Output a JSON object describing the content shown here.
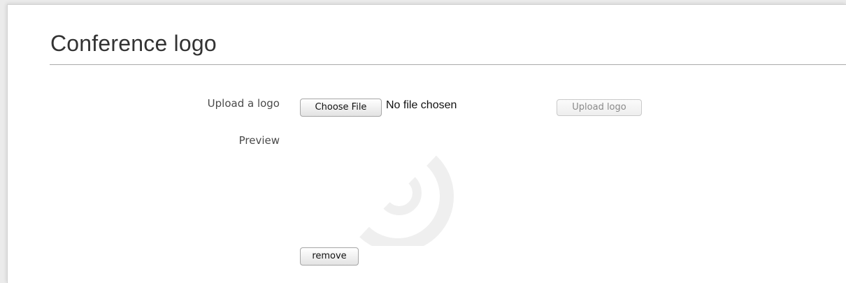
{
  "section": {
    "title": "Conference logo"
  },
  "upload": {
    "label": "Upload a logo",
    "choose_button": "Choose File",
    "file_status": "No file chosen",
    "upload_button": "Upload logo"
  },
  "preview": {
    "label": "Preview",
    "loading_icon": "spinner-icon",
    "remove_button": "remove"
  },
  "colors": {
    "background": "#ebebeb",
    "panel": "#ffffff",
    "title_text": "#333333",
    "label_text": "#4a4a4a",
    "disabled_button_text": "#8a8a8a",
    "spinner": "#efefef"
  }
}
